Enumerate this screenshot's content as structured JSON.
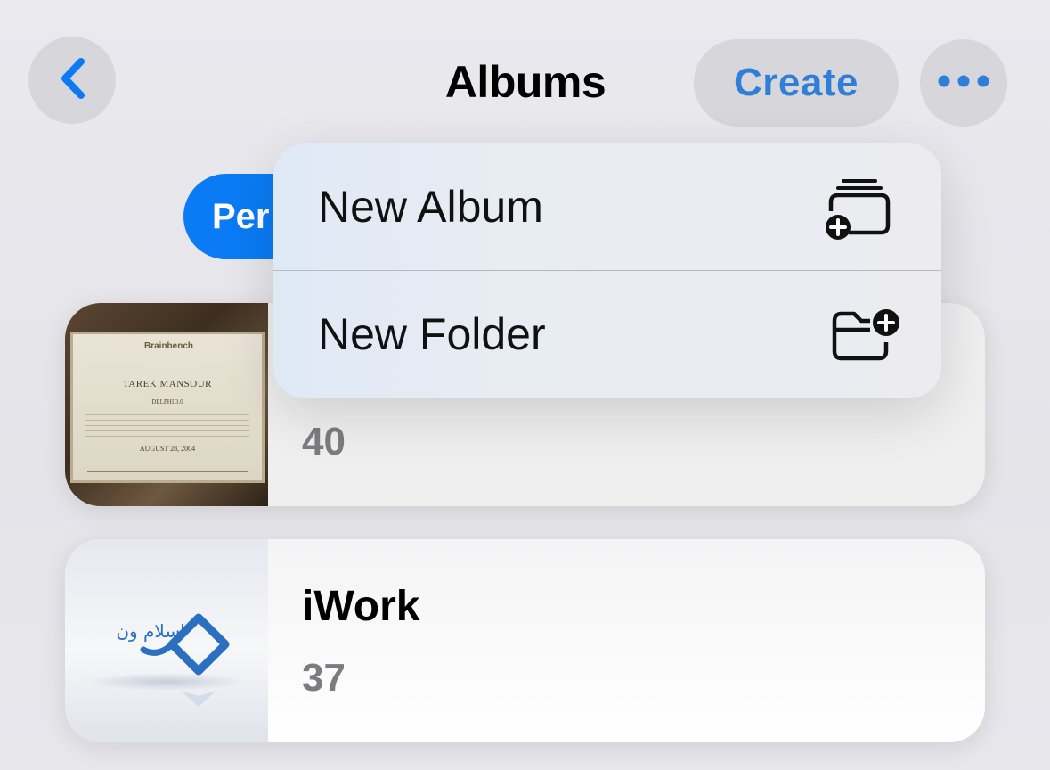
{
  "header": {
    "title": "Albums",
    "create_label": "Create",
    "back_icon": "chevron-left-icon",
    "more_icon": "ellipsis-icon"
  },
  "segment": {
    "visible_label": "Per"
  },
  "albums": [
    {
      "title": "",
      "count": "40",
      "thumbnail": {
        "type": "certificate-photo",
        "logo_text": "Brainbench",
        "name": "TAREK MANSOUR",
        "subtitle": "DELPHI 3.0",
        "date": "AUGUST 28, 2004"
      }
    },
    {
      "title": "iWork",
      "count": "37",
      "thumbnail": {
        "type": "logo",
        "logo_text": "اسلام ون"
      }
    }
  ],
  "menu": {
    "items": [
      {
        "label": "New Album",
        "icon": "stacked-album-plus-icon"
      },
      {
        "label": "New Folder",
        "icon": "folder-plus-icon"
      }
    ]
  },
  "colors": {
    "accent": "#2f7fd9",
    "segment_blue": "#0a7bf5",
    "secondary_text": "#7b7b80"
  }
}
